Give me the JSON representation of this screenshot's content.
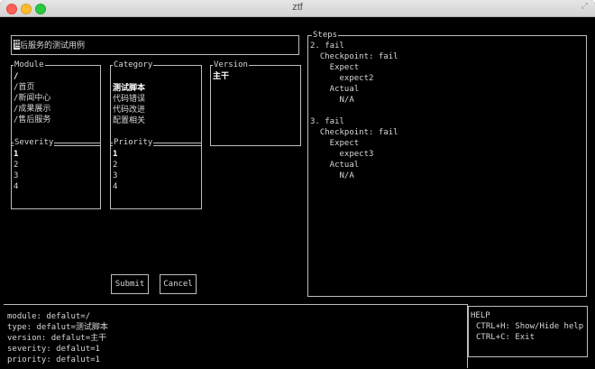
{
  "window": {
    "title": "ztf"
  },
  "colors": {
    "background": "#000000",
    "foreground": "#d6d6d6",
    "border": "#bdbdbd",
    "close": "#fc5f57",
    "minimize": "#fdbc2e",
    "zoom": "#29c940"
  },
  "title_input": {
    "cursor_char": "售",
    "value": "后服务的测试用例"
  },
  "module": {
    "label": "Module",
    "items": [
      "/",
      "/首页",
      "/新闻中心",
      "/成果展示",
      "/售后服务"
    ],
    "selected": 0
  },
  "category": {
    "label": "Category",
    "items": [
      "测试脚本",
      "代码错误",
      "代码改进",
      "配置相关"
    ],
    "selected": 0
  },
  "version": {
    "label": "Version",
    "items": [
      "主干"
    ],
    "selected": 0
  },
  "severity": {
    "label": "Severity",
    "items": [
      "1",
      "2",
      "3",
      "4"
    ],
    "selected": 0
  },
  "priority": {
    "label": "Priority",
    "items": [
      "1",
      "2",
      "3",
      "4"
    ],
    "selected": 0
  },
  "buttons": {
    "submit": "Submit",
    "cancel": "Cancel"
  },
  "steps": {
    "label": "Steps",
    "lines": [
      "2. fail",
      "  Checkpoint: fail",
      "    Expect",
      "      expect2",
      "    Actual",
      "      N/A",
      "",
      "3. fail",
      "  Checkpoint: fail",
      "    Expect",
      "      expect3",
      "    Actual",
      "      N/A"
    ]
  },
  "status": {
    "lines": [
      "module: defalut=/",
      "type: defalut=测试脚本",
      "version: defalut=主干",
      "severity: defalut=1",
      "priority: defalut=1"
    ]
  },
  "help": {
    "title": "HELP",
    "lines": [
      "CTRL+H: Show/Hide help",
      "CTRL+C: Exit"
    ]
  }
}
